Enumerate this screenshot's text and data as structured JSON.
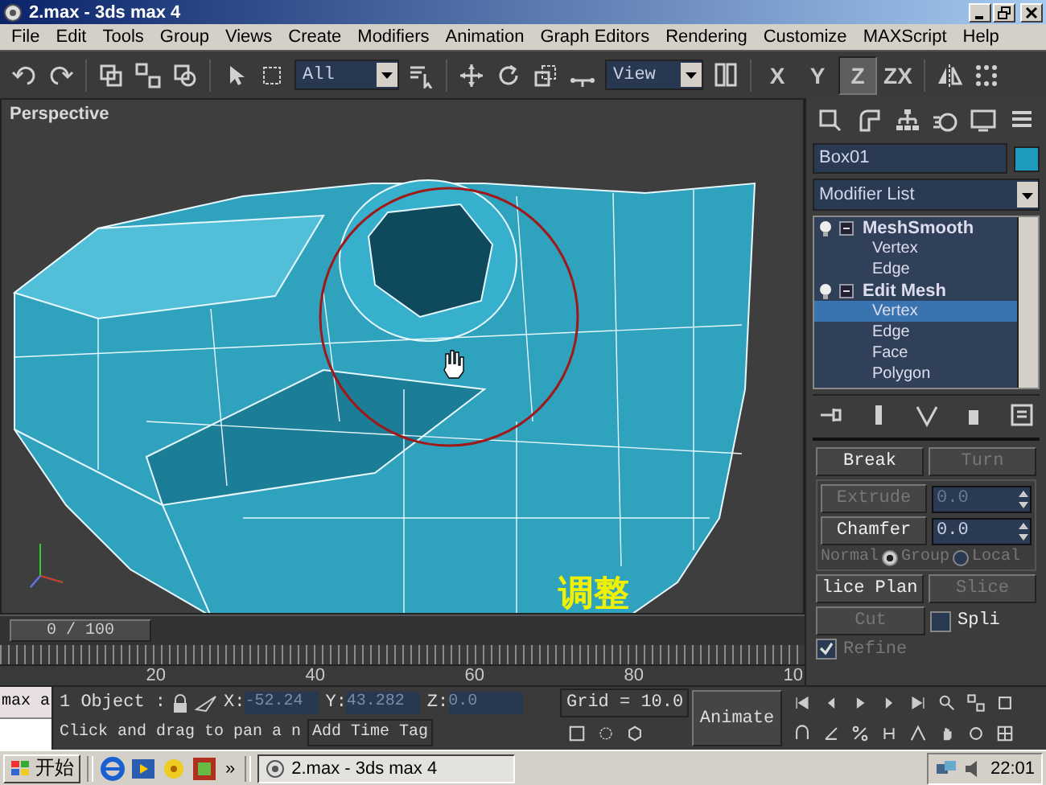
{
  "window": {
    "title": "2.max - 3ds max 4"
  },
  "menu": [
    "File",
    "Edit",
    "Tools",
    "Group",
    "Views",
    "Create",
    "Modifiers",
    "Animation",
    "Graph Editors",
    "Rendering",
    "Customize",
    "MAXScript",
    "Help"
  ],
  "toolbar": {
    "selection_filter": "All",
    "reference_coord": "View",
    "axis_buttons": [
      {
        "label": "X",
        "selected": false
      },
      {
        "label": "Y",
        "selected": false
      },
      {
        "label": "Z",
        "selected": true
      },
      {
        "label": "ZX",
        "selected": false
      }
    ]
  },
  "viewport": {
    "label": "Perspective",
    "caption": "调整",
    "time_slider": "0 / 100"
  },
  "trackbar": {
    "ticks": [
      "20",
      "40",
      "60",
      "80",
      "10"
    ]
  },
  "command_panel": {
    "object_name": "Box01",
    "modifier_list": "Modifier List",
    "stack": [
      {
        "label": "MeshSmooth",
        "expanded": true,
        "children": [
          {
            "label": "Vertex",
            "selected": false
          },
          {
            "label": "Edge",
            "selected": false
          }
        ]
      },
      {
        "label": "Edit Mesh",
        "expanded": true,
        "children": [
          {
            "label": "Vertex",
            "selected": true
          },
          {
            "label": "Edge",
            "selected": false
          },
          {
            "label": "Face",
            "selected": false
          },
          {
            "label": "Polygon",
            "selected": false
          }
        ]
      }
    ],
    "rollout": {
      "top_buttons": [
        {
          "label": "Break",
          "disabled": false
        },
        {
          "label": "Turn",
          "disabled": true
        }
      ],
      "spinners": [
        {
          "label": "Extrude",
          "disabled": true,
          "value": "0.0"
        },
        {
          "label": "Chamfer",
          "disabled": false,
          "value": "0.0"
        }
      ],
      "normal": {
        "label": "Normal",
        "disabled": true,
        "options": [
          {
            "label": "Group",
            "selected": true
          },
          {
            "label": "Local",
            "selected": false
          }
        ]
      },
      "slice_buttons": [
        {
          "label": "lice Plan",
          "disabled": false
        },
        {
          "label": "Slice",
          "disabled": true
        }
      ],
      "cut": {
        "label": "Cut",
        "disabled": true
      },
      "split": {
        "label": "Spli",
        "checked": false
      },
      "refine": {
        "label": "Refine",
        "checked": true,
        "disabled": true
      }
    }
  },
  "status": {
    "max_field": "max a",
    "selection": "1 Object :",
    "coords": [
      {
        "axis": "X:",
        "value": "-52.24"
      },
      {
        "axis": "Y:",
        "value": "43.282"
      },
      {
        "axis": "Z:",
        "value": "0.0"
      }
    ],
    "grid": "Grid = 10.0",
    "prompt": "Click and drag to pan a n",
    "time_tag": "Add Time Tag",
    "animate": "Animate"
  },
  "taskbar": {
    "start": "开始",
    "more": "»",
    "task": "2.max - 3ds max 4",
    "clock": "22:01"
  }
}
